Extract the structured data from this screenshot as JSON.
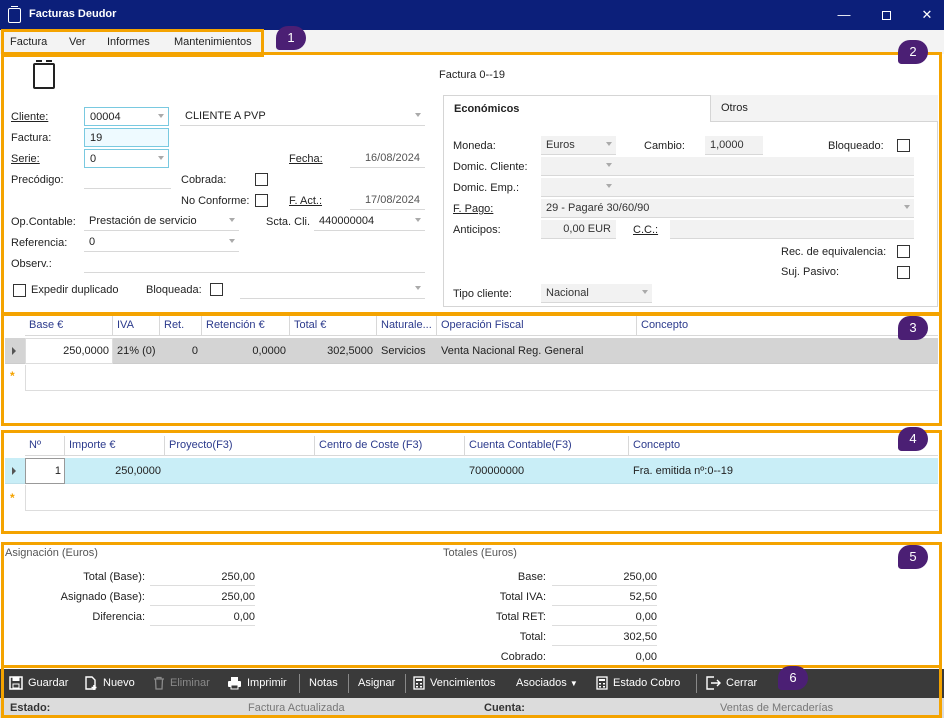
{
  "window": {
    "title": "Facturas Deudor"
  },
  "menu": {
    "items": [
      "Factura",
      "Ver",
      "Informes",
      "Mantenimientos"
    ]
  },
  "badges": [
    "1",
    "2",
    "3",
    "4",
    "5",
    "6"
  ],
  "header": {
    "factura_title": "Factura 0--19",
    "cliente_label": "Cliente:",
    "cliente_code": "00004",
    "cliente_name": "CLIENTE A PVP",
    "factura_label": "Factura:",
    "factura_value": "19",
    "serie_label": "Serie:",
    "serie_value": "0",
    "fecha_label": "Fecha:",
    "fecha_value": "16/08/2024",
    "precodigo_label": "Precódigo:",
    "cobrada_label": "Cobrada:",
    "no_conforme_label": "No Conforme:",
    "f_act_label": "F. Act.:",
    "f_act_value": "17/08/2024",
    "op_contable_label": "Op.Contable:",
    "op_contable_value": "Prestación de servicio",
    "scta_cli_label": "Scta. Cli.",
    "scta_cli_value": "440000004",
    "referencia_label": "Referencia:",
    "referencia_value": "0",
    "observ_label": "Observ.:",
    "expedir_label": "Expedir duplicado",
    "bloqueada_label": "Bloqueada:"
  },
  "tabs": {
    "economicos": "Económicos",
    "otros": "Otros"
  },
  "economicos": {
    "moneda_label": "Moneda:",
    "moneda_value": "Euros",
    "cambio_label": "Cambio:",
    "cambio_value": "1,0000",
    "bloqueado_label": "Bloqueado:",
    "domic_cliente_label": "Domic. Cliente:",
    "domic_emp_label": "Domic. Emp.:",
    "f_pago_label": "F. Pago:",
    "f_pago_value": "29 - Pagaré 30/60/90",
    "anticipos_label": "Anticipos:",
    "anticipos_value": "0,00 EUR",
    "cc_label": "C.C.:",
    "rec_equiv_label": "Rec. de equivalencia:",
    "suj_pasivo_label": "Suj. Pasivo:",
    "tipo_cliente_label": "Tipo cliente:",
    "tipo_cliente_value": "Nacional"
  },
  "grid1": {
    "columns": [
      "Base €",
      "IVA",
      "Ret.",
      "Retención €",
      "Total €",
      "Naturale...",
      "Operación Fiscal",
      "Concepto"
    ],
    "rows": [
      [
        "250,0000",
        "21% (0)",
        "0",
        "0,0000",
        "302,5000",
        "Servicios",
        "Venta Nacional Reg. General",
        ""
      ]
    ]
  },
  "grid2": {
    "columns": [
      "Nº",
      "Importe €",
      "Proyecto(F3)",
      "Centro de Coste (F3)",
      "Cuenta Contable(F3)",
      "Concepto"
    ],
    "rows": [
      [
        "1",
        "250,0000",
        "",
        "",
        "700000000",
        "Fra. emitida nº:0--19"
      ]
    ]
  },
  "asignacion": {
    "title": "Asignación (Euros)",
    "total_base_label": "Total (Base):",
    "total_base_value": "250,00",
    "asignado_label": "Asignado (Base):",
    "asignado_value": "250,00",
    "diferencia_label": "Diferencia:",
    "diferencia_value": "0,00"
  },
  "totales": {
    "title": "Totales (Euros)",
    "base_label": "Base:",
    "base_value": "250,00",
    "iva_label": "Total IVA:",
    "iva_value": "52,50",
    "ret_label": "Total RET:",
    "ret_value": "0,00",
    "total_label": "Total:",
    "total_value": "302,50",
    "cobrado_label": "Cobrado:",
    "cobrado_value": "0,00"
  },
  "toolbar": {
    "guardar": "Guardar",
    "nuevo": "Nuevo",
    "eliminar": "Eliminar",
    "imprimir": "Imprimir",
    "notas": "Notas",
    "asignar": "Asignar",
    "vencimientos": "Vencimientos",
    "asociados": "Asociados",
    "estado_cobro": "Estado Cobro",
    "cerrar": "Cerrar"
  },
  "status": {
    "estado_label": "Estado:",
    "estado_value": "Factura Actualizada",
    "cuenta_label": "Cuenta:",
    "cuenta_value": "Ventas de Mercaderías"
  },
  "colors": {
    "titlebar": "#0c1f7a",
    "highlight": "#f4a300",
    "badge": "#4b1f74",
    "selected_row": "#c9eef7"
  }
}
